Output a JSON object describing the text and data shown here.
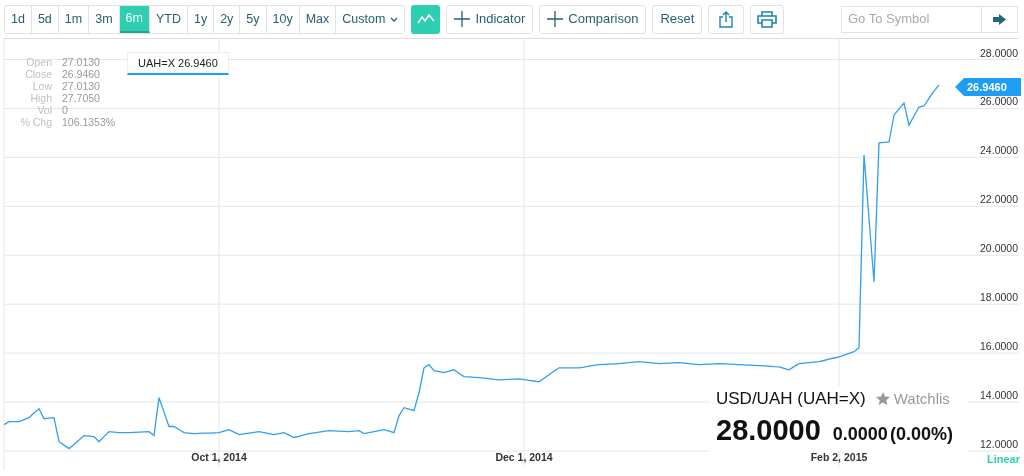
{
  "toolbar": {
    "ranges": [
      {
        "label": "1d",
        "selected": false
      },
      {
        "label": "5d",
        "selected": false
      },
      {
        "label": "1m",
        "selected": false
      },
      {
        "label": "3m",
        "selected": false
      },
      {
        "label": "6m",
        "selected": true
      },
      {
        "label": "YTD",
        "selected": false
      },
      {
        "label": "1y",
        "selected": false
      },
      {
        "label": "2y",
        "selected": false
      },
      {
        "label": "5y",
        "selected": false
      },
      {
        "label": "10y",
        "selected": false
      },
      {
        "label": "Max",
        "selected": false
      }
    ],
    "custom": "Custom",
    "chart_type": {
      "selected": true
    },
    "indicator": "Indicator",
    "comparison": "Comparison",
    "reset": "Reset",
    "symbol_search": {
      "placeholder": "Go To Symbol"
    }
  },
  "ohlc": [
    {
      "label": "Open",
      "value": "27.0130"
    },
    {
      "label": "Close",
      "value": "26.9460"
    },
    {
      "label": "Low",
      "value": "27.0130"
    },
    {
      "label": "High",
      "value": "27.7050"
    },
    {
      "label": "Vol",
      "value": "0"
    },
    {
      "label": "% Chg",
      "value": "106.1353%"
    }
  ],
  "tooltip": "UAH=X 26.9460",
  "price_marker": "26.9460",
  "quote": {
    "name": "USD/UAH (UAH=X)",
    "watchlist": "Watchlis",
    "price": "28.0000",
    "change": "0.0000",
    "change_pct": "(0.00%)"
  },
  "scale": "Linear",
  "chart_data": {
    "type": "line",
    "grid": true,
    "ylim": [
      12,
      28
    ],
    "yticks": [
      {
        "value": 12,
        "label": "12.0000"
      },
      {
        "value": 14,
        "label": "14.0000"
      },
      {
        "value": 16,
        "label": "16.0000"
      },
      {
        "value": 18,
        "label": "18.0000"
      },
      {
        "value": 20,
        "label": "20.0000"
      },
      {
        "value": 22,
        "label": "22.0000"
      },
      {
        "value": 24,
        "label": "24.0000"
      },
      {
        "value": 26,
        "label": "26.0000"
      },
      {
        "value": 28,
        "label": "28.0000"
      }
    ],
    "categories": [
      null,
      null,
      null,
      null,
      null,
      null,
      null,
      null,
      null,
      null,
      null,
      null,
      null,
      null,
      null,
      null,
      null,
      null,
      null,
      null,
      null,
      null,
      null,
      null,
      null,
      null,
      null,
      null,
      null,
      null,
      null,
      null,
      null,
      null,
      null,
      null,
      null,
      null,
      null,
      null,
      null,
      null,
      null,
      "Oct 1, 2014",
      null,
      null,
      null,
      null,
      null,
      null,
      null,
      null,
      null,
      null,
      null,
      null,
      null,
      null,
      null,
      null,
      null,
      null,
      null,
      null,
      null,
      null,
      null,
      null,
      null,
      null,
      null,
      null,
      null,
      null,
      null,
      null,
      null,
      null,
      null,
      null,
      null,
      null,
      null,
      null,
      null,
      null,
      null,
      null,
      null,
      null,
      null,
      null,
      null,
      null,
      null,
      null,
      null,
      null,
      null,
      null,
      null,
      null,
      null,
      null,
      "Dec 1, 2014",
      null,
      null,
      null,
      null,
      null,
      null,
      null,
      null,
      null,
      null,
      null,
      null,
      null,
      null,
      null,
      null,
      null,
      null,
      null,
      null,
      null,
      null,
      null,
      null,
      null,
      null,
      null,
      null,
      null,
      null,
      null,
      null,
      null,
      null,
      null,
      null,
      null,
      null,
      null,
      null,
      null,
      null,
      null,
      null,
      null,
      null,
      null,
      null,
      null,
      null,
      null,
      null,
      null,
      null,
      null,
      null,
      null,
      null,
      null,
      null,
      null,
      null,
      "Feb 2, 2015",
      null,
      null,
      null,
      null,
      null,
      null,
      null,
      null,
      null,
      null,
      null,
      null,
      null,
      null,
      null,
      null,
      null,
      null,
      null,
      null,
      null,
      null,
      null,
      null,
      null,
      null,
      null,
      null,
      null,
      null,
      null,
      null,
      null,
      null,
      null,
      null
    ],
    "series": [
      {
        "color": "#2f9ff0",
        "values": [
          13.08,
          13.2,
          13.2,
          13.2,
          13.28,
          13.36,
          13.55,
          13.73,
          13.32,
          13.34,
          13.36,
          12.38,
          12.24,
          12.1,
          12.26,
          12.45,
          12.63,
          12.61,
          12.59,
          12.38,
          12.59,
          12.79,
          12.77,
          12.75,
          12.75,
          12.75,
          12.76,
          12.77,
          12.78,
          12.79,
          12.63,
          14.18,
          13.59,
          13.0,
          13.0,
          12.88,
          12.75,
          12.73,
          12.71,
          12.72,
          12.73,
          12.73,
          12.74,
          12.75,
          12.81,
          12.87,
          12.77,
          12.67,
          12.7,
          12.73,
          12.76,
          12.79,
          12.75,
          12.71,
          12.67,
          12.71,
          12.75,
          12.65,
          12.55,
          12.6,
          12.66,
          12.71,
          12.74,
          12.77,
          12.8,
          12.83,
          12.82,
          12.81,
          12.8,
          12.79,
          12.81,
          12.83,
          12.71,
          12.75,
          12.79,
          12.83,
          12.87,
          12.81,
          12.75,
          13.44,
          13.77,
          13.71,
          13.65,
          14.38,
          15.4,
          15.53,
          15.28,
          15.24,
          15.2,
          15.26,
          15.32,
          15.18,
          15.04,
          15.03,
          15.01,
          15.0,
          14.98,
          14.96,
          14.93,
          14.91,
          14.92,
          14.93,
          14.94,
          14.95,
          14.92,
          14.89,
          14.86,
          14.83,
          14.97,
          15.12,
          15.26,
          15.4,
          15.4,
          15.4,
          15.4,
          15.4,
          15.43,
          15.47,
          15.5,
          15.53,
          15.54,
          15.55,
          15.56,
          15.57,
          15.59,
          15.61,
          15.63,
          15.65,
          15.63,
          15.61,
          15.59,
          15.57,
          15.58,
          15.59,
          15.6,
          15.61,
          15.59,
          15.57,
          15.55,
          15.53,
          15.54,
          15.55,
          15.56,
          15.57,
          15.56,
          15.55,
          15.54,
          15.53,
          15.52,
          15.51,
          15.5,
          15.49,
          15.48,
          15.47,
          15.45,
          15.44,
          15.38,
          15.32,
          15.45,
          15.57,
          15.59,
          15.61,
          15.63,
          15.65,
          15.7,
          15.75,
          15.8,
          15.85,
          15.92,
          15.99,
          16.06,
          16.22,
          24.1,
          21.5,
          18.91,
          24.59,
          24.61,
          24.63,
          25.73,
          25.98,
          26.22,
          25.32,
          25.69,
          26.06,
          26.1,
          26.41,
          26.71,
          26.95,
          null,
          null,
          null,
          null,
          null,
          null,
          null,
          null,
          null,
          null,
          null,
          null,
          null,
          null,
          null,
          null
        ]
      }
    ]
  }
}
